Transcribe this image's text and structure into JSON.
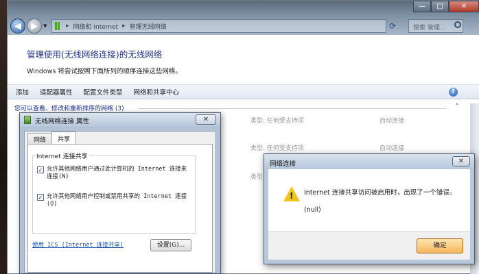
{
  "explorer": {
    "breadcrumb": [
      "网络和 Internet",
      "管理无线网络"
    ],
    "search_placeholder": "搜索 管理...",
    "title": "管理使用(无线网络连接)的无线网络",
    "description": "Windows 将尝试按照下面所列的顺序连接这些网络。",
    "toolbar": [
      "添加",
      "适配器属性",
      "配置文件类型",
      "网络和共享中心"
    ],
    "group_header": "您可以查看、修改和重新排序的网络 (3)",
    "networks": [
      {
        "type": "类型: 任何受支持项",
        "mode": "自动连接"
      },
      {
        "type": "类型: 任何受支持项",
        "mode": "自动连接"
      },
      {
        "type": "类型:"
      }
    ]
  },
  "properties_dialog": {
    "title": "无线网络连接 属性",
    "close": "✕",
    "tabs": [
      "网络",
      "共享"
    ],
    "section_label": "Internet 连接共享",
    "checkbox1": "允许其他网络用户通过此计算机的 Internet 连接来连接(N)",
    "checkbox2": "允许其他网络用户控制或禁用共享的 Internet 连接(O)",
    "link": "使用 ICS (Internet 连接共享)",
    "settings_button": "设置(G)..."
  },
  "error_dialog": {
    "title": "网络连接",
    "close": "✕",
    "message": "Internet 连接共享访问被启用时，出现了一个错误。",
    "detail": "(null)",
    "ok_button": "确定"
  }
}
